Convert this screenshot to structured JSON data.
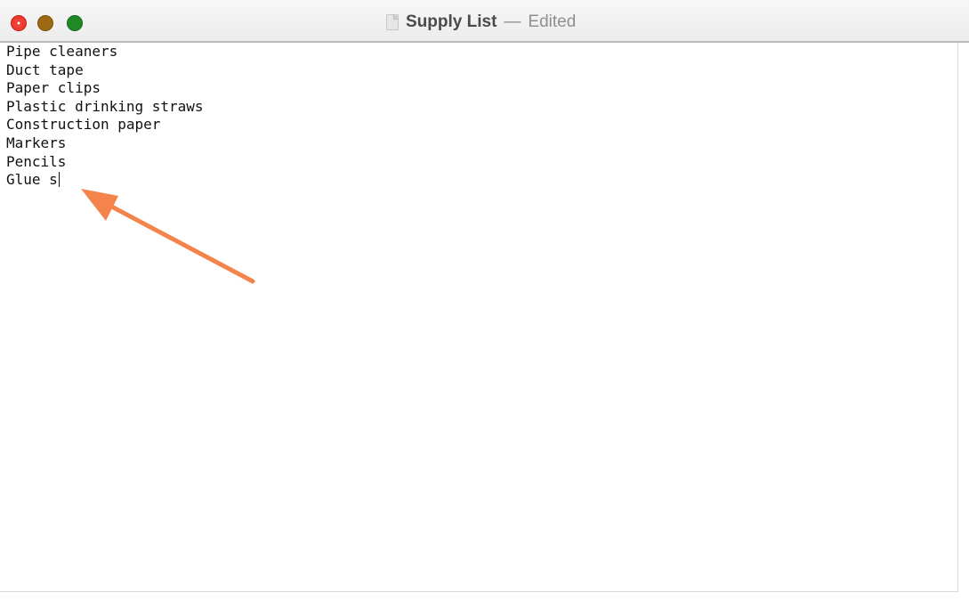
{
  "window": {
    "title": "Supply List",
    "separator": "—",
    "status": "Edited",
    "controls": [
      "close",
      "minimize",
      "zoom"
    ],
    "colors": {
      "close": "#ee3b2f",
      "minimize": "#9b6a13",
      "zoom": "#1f8a25",
      "annotation_arrow": "#f5844c"
    }
  },
  "document": {
    "lines": [
      "Pipe cleaners",
      "Duct tape",
      "Paper clips",
      "Plastic drinking straws",
      "Construction paper",
      "Markers",
      "Pencils",
      "Glue s"
    ]
  },
  "annotation": {
    "type": "arrow",
    "icon": "arrow-icon",
    "points_to": "text-caret"
  }
}
